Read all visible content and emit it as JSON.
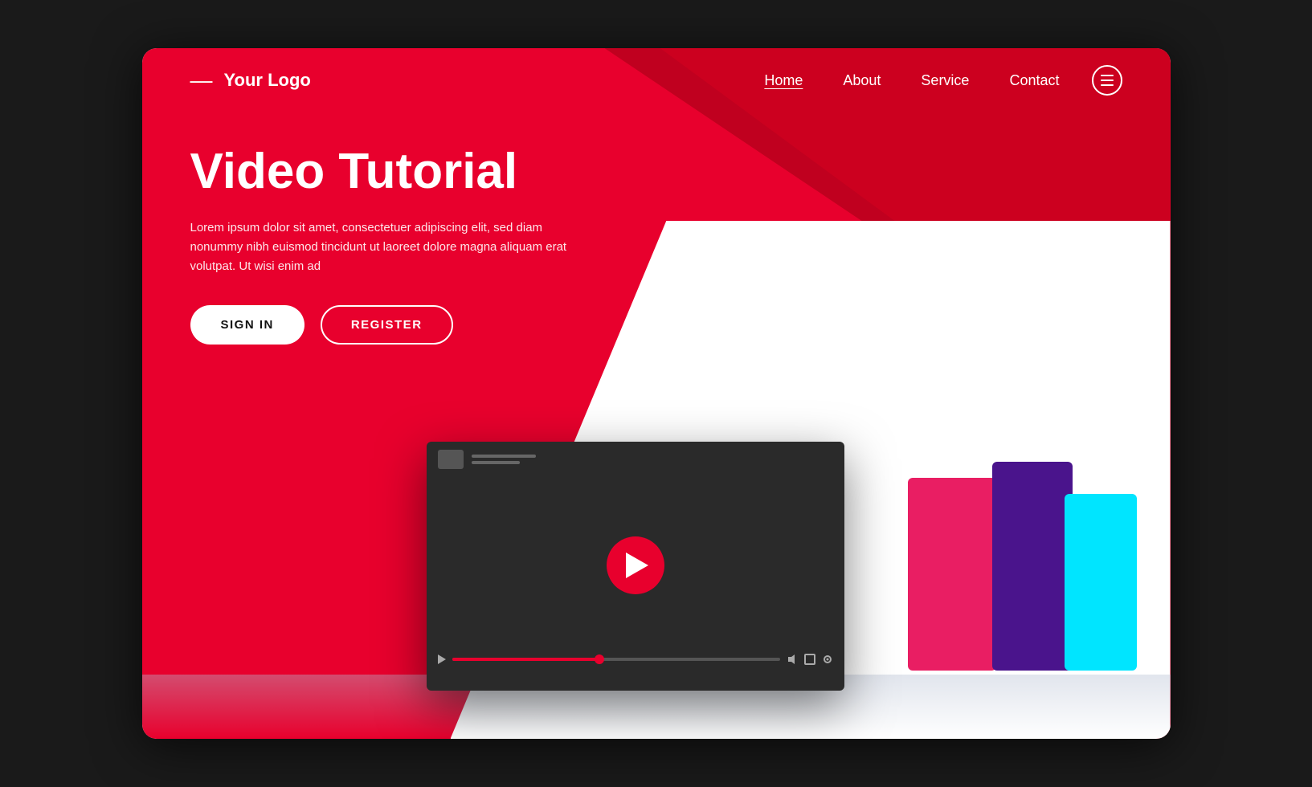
{
  "brand": {
    "logo_dash": "—",
    "logo_text": "Your Logo"
  },
  "nav": {
    "links": [
      {
        "label": "Home",
        "active": true
      },
      {
        "label": "About",
        "active": false
      },
      {
        "label": "Service",
        "active": false
      },
      {
        "label": "Contact",
        "active": false
      }
    ],
    "menu_icon_label": "☰"
  },
  "hero": {
    "title": "Video Tutorial",
    "description": "Lorem ipsum dolor sit amet, consectetuer adipiscing elit, sed diam nonummy nibh euismod tincidunt ut laoreet dolore magna aliquam erat volutpat. Ut wisi enim ad",
    "btn_signin": "SIGN IN",
    "btn_register": "REGISTER"
  },
  "player": {
    "play_button_label": "▶"
  },
  "colors": {
    "primary_red": "#e8002d",
    "dark_bg": "#1a1a1a",
    "white": "#ffffff"
  }
}
